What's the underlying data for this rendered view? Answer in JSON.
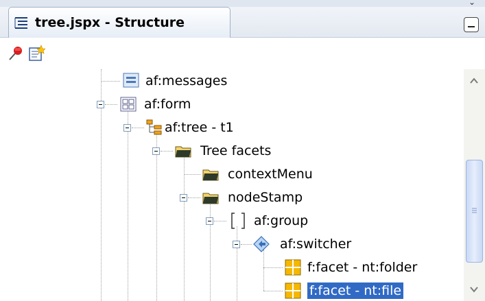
{
  "panel": {
    "title": "tree.jspx - Structure"
  },
  "toolbar": {
    "buttons": [
      {
        "icon": "pin-icon"
      },
      {
        "icon": "freeze-view-icon"
      }
    ]
  },
  "tree": {
    "nodes": [
      {
        "label": "af:messages",
        "icon": "messages-icon",
        "expanded": null
      },
      {
        "label": "af:form",
        "icon": "form-icon",
        "expanded": true
      },
      {
        "label": "af:tree - t1",
        "icon": "tree-icon",
        "expanded": true
      },
      {
        "label": "Tree facets",
        "icon": "folder-icon",
        "expanded": true
      },
      {
        "label": "contextMenu",
        "icon": "folder-icon",
        "expanded": null
      },
      {
        "label": "nodeStamp",
        "icon": "folder-icon",
        "expanded": true
      },
      {
        "label": "af:group",
        "icon": "group-icon",
        "expanded": true
      },
      {
        "label": "af:switcher",
        "icon": "switcher-icon",
        "expanded": true
      },
      {
        "label": "f:facet - nt:folder",
        "icon": "facet-icon",
        "expanded": null
      },
      {
        "label": "f:facet - nt:file",
        "icon": "facet-icon",
        "expanded": null,
        "selected": true
      }
    ]
  },
  "colors": {
    "selection": "#316ac5",
    "folder": "#f3d36b",
    "facet": "#f5b800"
  }
}
